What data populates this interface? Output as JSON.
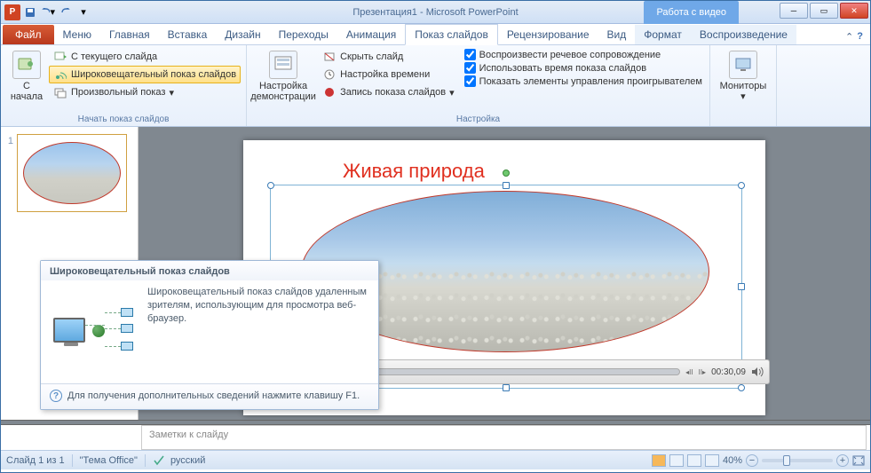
{
  "title": "Презентация1  - Microsoft PowerPoint",
  "context_tab": "Работа с видео",
  "tabs": {
    "file": "Файл",
    "list": [
      "Меню",
      "Главная",
      "Вставка",
      "Дизайн",
      "Переходы",
      "Анимация",
      "Показ слайдов",
      "Рецензирование",
      "Вид",
      "Формат",
      "Воспроизведение"
    ],
    "active": "Показ слайдов"
  },
  "ribbon": {
    "group_start": {
      "from_beginning": "С начала",
      "from_current": "С текущего слайда",
      "broadcast": "Широковещательный показ слайдов",
      "custom": "Произвольный показ",
      "label": "Начать показ слайдов"
    },
    "group_setup": {
      "setup_big": "Настройка демонстрации",
      "hide": "Скрыть слайд",
      "rehearse": "Настройка времени",
      "record": "Запись показа слайдов",
      "chk_narr": "Воспроизвести речевое сопровождение",
      "chk_timings": "Использовать время показа слайдов",
      "chk_media": "Показать элементы управления проигрывателем",
      "label": "Настройка"
    },
    "group_monitors": {
      "monitors": "Мониторы"
    }
  },
  "tooltip": {
    "head": "Широковещательный показ слайдов",
    "desc": "Широковещательный показ слайдов удаленным зрителям, использующим для просмотра веб-браузер.",
    "foot": "Для получения дополнительных сведений нажмите клавишу F1."
  },
  "slide": {
    "title": "Живая природа"
  },
  "player": {
    "time": "00:30,09"
  },
  "notes": "Заметки к слайду",
  "status": {
    "slide": "Слайд 1 из 1",
    "theme": "\"Тема Office\"",
    "lang": "русский",
    "zoom": "40%"
  }
}
